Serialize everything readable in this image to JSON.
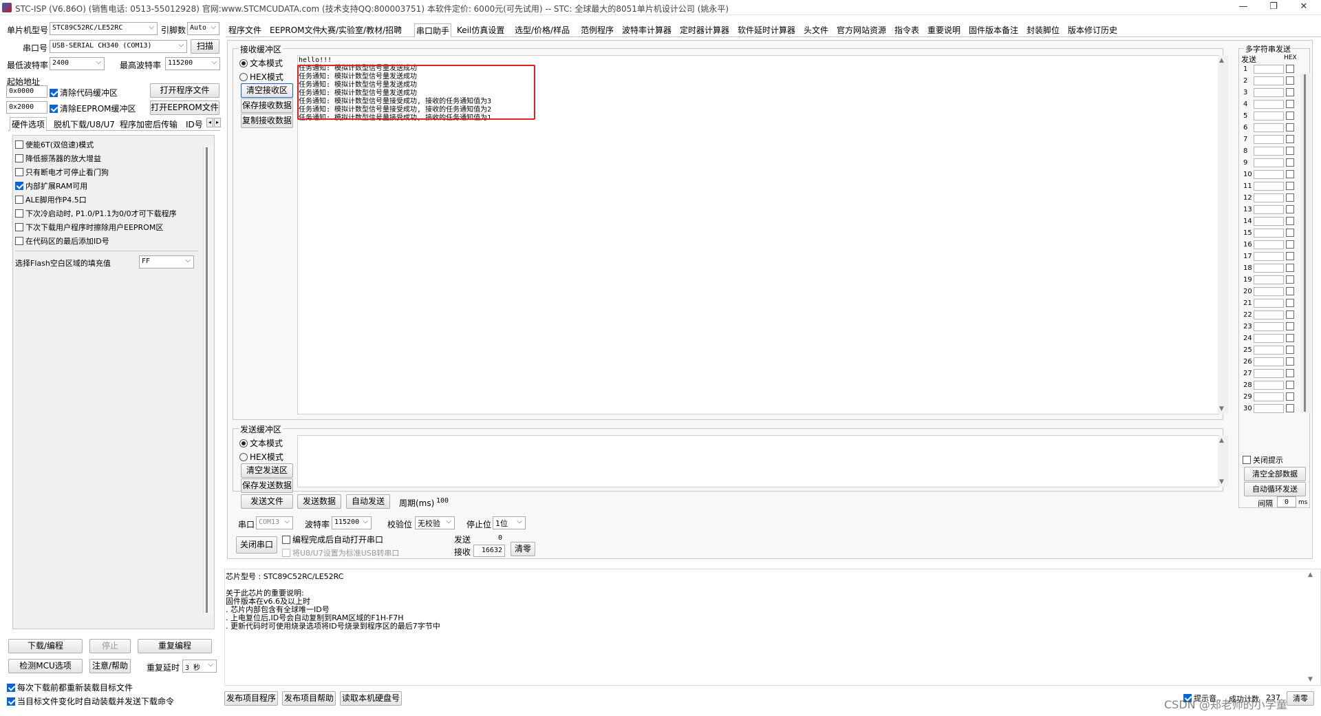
{
  "window": {
    "title": "STC-ISP (V6.86O) (销售电话: 0513-55012928) 官网:www.STCMCUDATA.com  (技术支持QQ:800003751) 本软件定价: 6000元(可先试用) -- STC: 全球最大的8051单片机设计公司 (姚永平)",
    "min": "—",
    "max": "❐",
    "close": "✕"
  },
  "left": {
    "mcu_label": "单片机型号",
    "mcu_value": "STC89C52RC/LE52RC",
    "pin_label": "引脚数",
    "pin_value": "Auto",
    "port_label": "串口号",
    "port_value": "USB-SERIAL CH340 (COM13)",
    "scan": "扫描",
    "min_baud_label": "最低波特率",
    "min_baud_value": "2400",
    "max_baud_label": "最高波特率",
    "max_baud_value": "115200",
    "start_addr_label": "起始地址",
    "code_addr": "0x0000",
    "clear_code": "清除代码缓冲区",
    "open_prog": "打开程序文件",
    "eeprom_addr": "0x2000",
    "clear_eeprom": "清除EEPROM缓冲区",
    "open_eeprom": "打开EEPROM文件",
    "tabs": [
      "硬件选项",
      "脱机下载/U8/U7",
      "程序加密后传输",
      "ID号"
    ],
    "options": [
      {
        "label": "使能6T(双倍速)模式",
        "checked": false
      },
      {
        "label": "降低振荡器的放大增益",
        "checked": false
      },
      {
        "label": "只有断电才可停止看门狗",
        "checked": false
      },
      {
        "label": "内部扩展RAM可用",
        "checked": true
      },
      {
        "label": "ALE脚用作P4.5口",
        "checked": false
      },
      {
        "label": "下次冷启动时, P1.0/P1.1为0/0才可下载程序",
        "checked": false
      },
      {
        "label": "下次下载用户程序时擦除用户EEPROM区",
        "checked": false
      },
      {
        "label": "在代码区的最后添加ID号",
        "checked": false
      }
    ],
    "fill_label": "选择Flash空白区域的填充值",
    "fill_value": "FF",
    "download": "下载/编程",
    "stop": "停止",
    "reprog": "重复编程",
    "detect": "检测MCU选项",
    "help": "注意/帮助",
    "delay_label": "重复延时",
    "delay_value": "3 秒",
    "reload": "每次下载前都重新装载目标文件",
    "autosend": "当目标文件变化时自动装载并发送下载命令"
  },
  "top_tabs": [
    "程序文件",
    "EEPROM文件",
    "大赛/实验室/教材/招聘",
    "串口助手",
    "Keil仿真设置",
    "选型/价格/样品",
    "范例程序",
    "波特率计算器",
    "定时器计算器",
    "软件延时计算器",
    "头文件",
    "官方网站资源",
    "指令表",
    "重要说明",
    "固件版本备注",
    "封装脚位",
    "版本修订历史"
  ],
  "recv": {
    "group": "接收缓冲区",
    "text_mode": "文本模式",
    "hex_mode": "HEX模式",
    "clear": "清空接收区",
    "save": "保存接收数据",
    "copy": "复制接收数据",
    "lines": [
      "hello!!!",
      "任务通知: 模拟计数型信号量发送成功",
      "任务通知: 模拟计数型信号量发送成功",
      "任务通知: 模拟计数型信号量发送成功",
      "任务通知: 模拟计数型信号量发送成功",
      "任务通知: 模拟计数型信号量接受成功, 接收的任务通知值为3",
      "任务通知: 模拟计数型信号量接受成功, 接收的任务通知值为2",
      "任务通知: 模拟计数型信号量接受成功, 接收的任务通知值为1"
    ],
    "highlight_color": "#e02020"
  },
  "send": {
    "group": "发送缓冲区",
    "text_mode": "文本模式",
    "hex_mode": "HEX模式",
    "clear": "清空发送区",
    "save": "保存发送数据",
    "send_file": "发送文件",
    "send_data": "发送数据",
    "auto_send": "自动发送",
    "period_label": "周期(ms)",
    "period_value": "100"
  },
  "serial": {
    "port_label": "串口",
    "port_value": "COM13",
    "baud_label": "波特率",
    "baud_value": "115200",
    "parity_label": "校验位",
    "parity_value": "无校验",
    "stop_label": "停止位",
    "stop_value": "1位",
    "close_port": "关闭串口",
    "auto_open": "编程完成后自动打开串口",
    "usb_cdc": "将U8/U7设置为标准USB转串口",
    "sent_label": "发送",
    "sent_value": "0",
    "recv_label": "接收",
    "recv_value": "16632",
    "clear": "清零"
  },
  "multi": {
    "title": "多字符串发送",
    "send_col": "发送",
    "hex_col": "HEX",
    "close_hint": "关闭提示",
    "clear_all": "清空全部数据",
    "auto_loop": "自动循环发送",
    "interval_label": "间隔",
    "interval_value": "0",
    "interval_unit": "ms"
  },
  "info": {
    "chip_label": "芯片型号 : STC89C52RC/LE52RC",
    "lines": [
      "关于此芯片的重要说明:",
      "  固件版本在v6.6及以上时",
      "  . 芯片内部包含有全球唯一ID号",
      "  . 上电复位后,ID号会自动复制到RAM区域的F1H-F7H",
      "  . 更新代码时可使用烧录选项将ID号烧录到程序区的最后7字节中"
    ]
  },
  "bottom": {
    "publish_prog": "发布项目程序",
    "publish_help": "发布项目帮助",
    "read_disk": "读取本机硬盘号",
    "hint": "提示音",
    "success_label": "成功计数",
    "success_value": "237",
    "clear": "清零",
    "watermark": "CSDN @郑老师的小学童"
  }
}
